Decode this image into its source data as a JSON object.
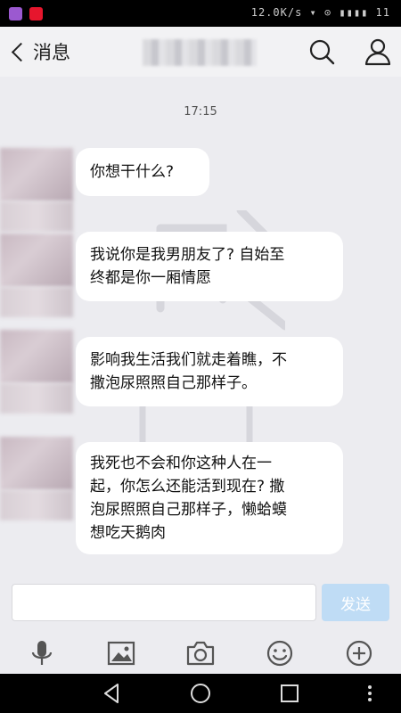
{
  "status_bar": {
    "right_text": "12.0K/s ▾ ⊙ ▮▮▮▮ 11"
  },
  "header": {
    "back_label": "消息",
    "contact_name_hidden": true
  },
  "chat": {
    "timestamp": "17:15",
    "messages": [
      {
        "direction": "incoming",
        "lines": [
          "你想干什么?"
        ]
      },
      {
        "direction": "incoming",
        "lines": [
          "我说你是我男朋友了? 自始至",
          "终都是你一厢情愿"
        ]
      },
      {
        "direction": "incoming",
        "lines": [
          "影响我生活我们就走着瞧，不",
          "撒泡尿照照自己那样子。"
        ]
      },
      {
        "direction": "incoming",
        "lines": [
          "我死也不会和你这种人在一",
          "起，你怎么还能活到现在? 撒",
          "泡尿照照自己那样子，懒蛤蟆",
          "想吃天鹅肉"
        ]
      }
    ]
  },
  "input": {
    "placeholder": "",
    "send_label": "发送"
  },
  "toolbar": {
    "icons": [
      "microphone-icon",
      "image-icon",
      "camera-icon",
      "emoji-icon",
      "plus-icon"
    ]
  },
  "nav": {
    "icons": [
      "back-triangle-icon",
      "home-circle-icon",
      "recents-square-icon",
      "more-dots-icon"
    ]
  },
  "colors": {
    "bubble": "#ffffff",
    "background": "#ececf0",
    "send_button": "#bfdcf5",
    "status_bar": "#000000"
  }
}
